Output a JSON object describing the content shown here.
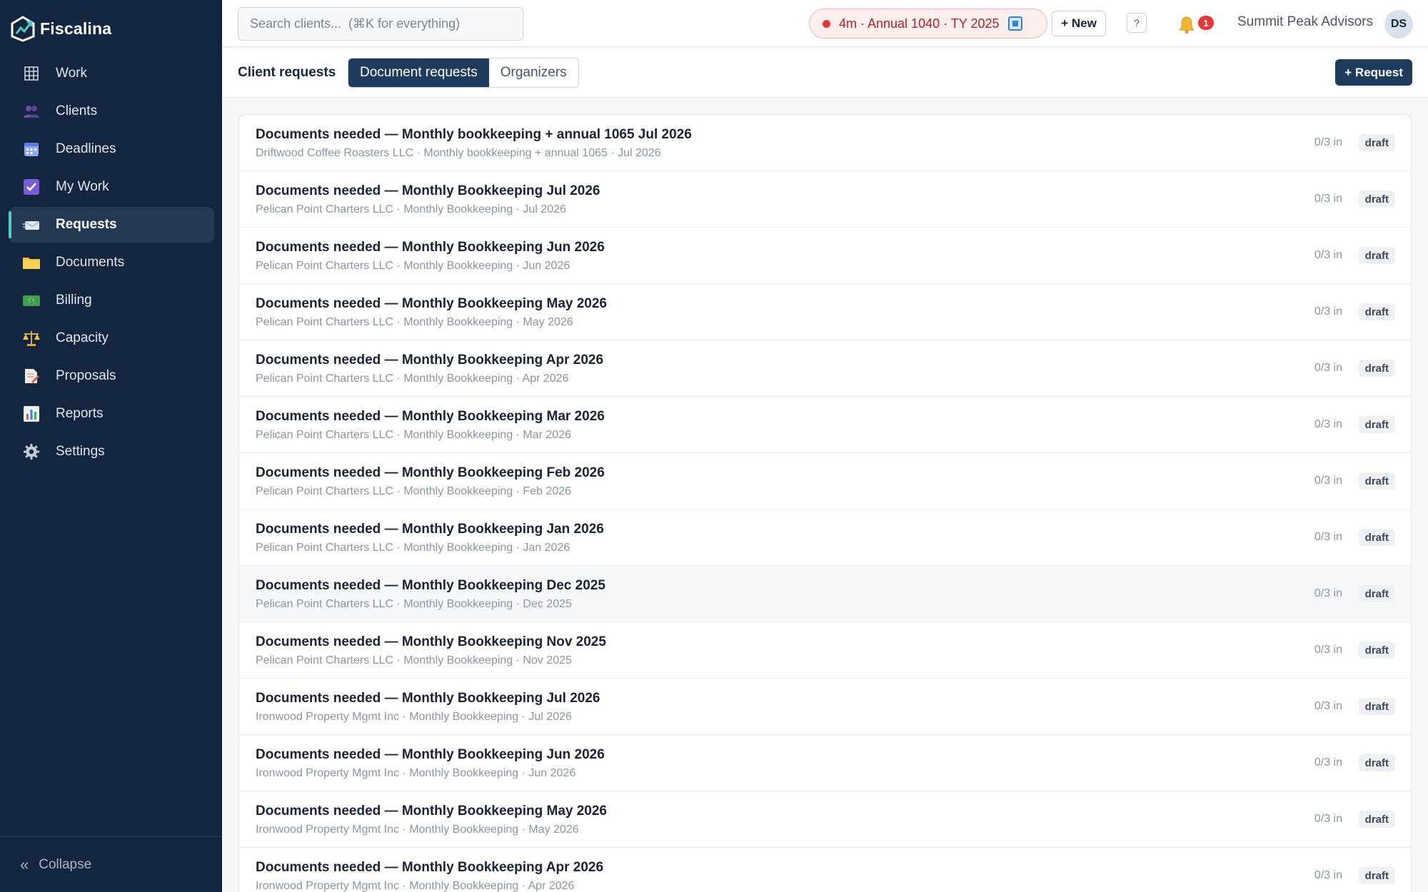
{
  "app": {
    "name": "Fiscalina"
  },
  "sidebar": {
    "items": [
      {
        "label": "Work",
        "icon": "grid-icon",
        "active": false
      },
      {
        "label": "Clients",
        "icon": "users-icon",
        "active": false
      },
      {
        "label": "Deadlines",
        "icon": "calendar-icon",
        "active": false
      },
      {
        "label": "My Work",
        "icon": "checkbox-icon",
        "active": false
      },
      {
        "label": "Requests",
        "icon": "inbox-icon",
        "active": true
      },
      {
        "label": "Documents",
        "icon": "folder-icon",
        "active": false
      },
      {
        "label": "Billing",
        "icon": "money-icon",
        "active": false
      },
      {
        "label": "Capacity",
        "icon": "scales-icon",
        "active": false
      },
      {
        "label": "Proposals",
        "icon": "document-pen-icon",
        "active": false
      },
      {
        "label": "Reports",
        "icon": "bar-chart-icon",
        "active": false
      },
      {
        "label": "Settings",
        "icon": "gear-icon",
        "active": false
      }
    ],
    "collapse_label": "Collapse",
    "collapse_icon": "«"
  },
  "topbar": {
    "search_placeholder": "Search clients...  (⌘K for everything)",
    "timer_text": "4m · Annual 1040 · TY 2025",
    "new_label": "+ New",
    "help_label": "?",
    "notification_count": "1",
    "org_name": "Summit Peak Advisors",
    "avatar_initials": "DS"
  },
  "subheader": {
    "title": "Client requests",
    "tabs": [
      {
        "label": "Document requests",
        "active": true
      },
      {
        "label": "Organizers",
        "active": false
      }
    ],
    "request_button": "+ Request"
  },
  "requests": [
    {
      "title": "Documents needed — Monthly bookkeeping + annual 1065 Jul 2026",
      "subtitle": "Driftwood Coffee Roasters LLC · Monthly bookkeeping + annual 1065 · Jul 2026",
      "count": "0/3 in",
      "status": "draft"
    },
    {
      "title": "Documents needed — Monthly Bookkeeping Jul 2026",
      "subtitle": "Pelican Point Charters LLC · Monthly Bookkeeping · Jul 2026",
      "count": "0/3 in",
      "status": "draft"
    },
    {
      "title": "Documents needed — Monthly Bookkeeping Jun 2026",
      "subtitle": "Pelican Point Charters LLC · Monthly Bookkeeping · Jun 2026",
      "count": "0/3 in",
      "status": "draft"
    },
    {
      "title": "Documents needed — Monthly Bookkeeping May 2026",
      "subtitle": "Pelican Point Charters LLC · Monthly Bookkeeping · May 2026",
      "count": "0/3 in",
      "status": "draft"
    },
    {
      "title": "Documents needed — Monthly Bookkeeping Apr 2026",
      "subtitle": "Pelican Point Charters LLC · Monthly Bookkeeping · Apr 2026",
      "count": "0/3 in",
      "status": "draft"
    },
    {
      "title": "Documents needed — Monthly Bookkeeping Mar 2026",
      "subtitle": "Pelican Point Charters LLC · Monthly Bookkeeping · Mar 2026",
      "count": "0/3 in",
      "status": "draft"
    },
    {
      "title": "Documents needed — Monthly Bookkeeping Feb 2026",
      "subtitle": "Pelican Point Charters LLC · Monthly Bookkeeping · Feb 2026",
      "count": "0/3 in",
      "status": "draft"
    },
    {
      "title": "Documents needed — Monthly Bookkeeping Jan 2026",
      "subtitle": "Pelican Point Charters LLC · Monthly Bookkeeping · Jan 2026",
      "count": "0/3 in",
      "status": "draft"
    },
    {
      "title": "Documents needed — Monthly Bookkeeping Dec 2025",
      "subtitle": "Pelican Point Charters LLC · Monthly Bookkeeping · Dec 2025",
      "count": "0/3 in",
      "status": "draft",
      "hover": true
    },
    {
      "title": "Documents needed — Monthly Bookkeeping Nov 2025",
      "subtitle": "Pelican Point Charters LLC · Monthly Bookkeeping · Nov 2025",
      "count": "0/3 in",
      "status": "draft"
    },
    {
      "title": "Documents needed — Monthly Bookkeeping Jul 2026",
      "subtitle": "Ironwood Property Mgmt Inc · Monthly Bookkeeping · Jul 2026",
      "count": "0/3 in",
      "status": "draft"
    },
    {
      "title": "Documents needed — Monthly Bookkeeping Jun 2026",
      "subtitle": "Ironwood Property Mgmt Inc · Monthly Bookkeeping · Jun 2026",
      "count": "0/3 in",
      "status": "draft"
    },
    {
      "title": "Documents needed — Monthly Bookkeeping May 2026",
      "subtitle": "Ironwood Property Mgmt Inc · Monthly Bookkeeping · May 2026",
      "count": "0/3 in",
      "status": "draft"
    },
    {
      "title": "Documents needed — Monthly Bookkeeping Apr 2026",
      "subtitle": "Ironwood Property Mgmt Inc · Monthly Bookkeeping · Apr 2026",
      "count": "0/3 in",
      "status": "draft"
    }
  ]
}
